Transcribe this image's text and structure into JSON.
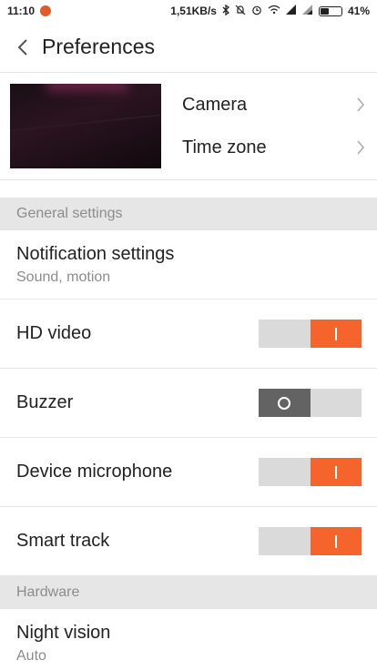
{
  "status_bar": {
    "time": "11:10",
    "speed": "1,51KB/s",
    "battery": "41%",
    "battery_level": 0.41
  },
  "header": {
    "title": "Preferences",
    "back_icon": "chevron-left-icon"
  },
  "camera_section": {
    "items": [
      {
        "label": "Camera",
        "icon": "chevron-right-icon"
      },
      {
        "label": "Time zone",
        "icon": "chevron-right-icon"
      }
    ]
  },
  "general": {
    "header": "General settings",
    "notification": {
      "title": "Notification settings",
      "subtitle": "Sound, motion"
    },
    "toggles": [
      {
        "label": "HD video",
        "on": true
      },
      {
        "label": "Buzzer",
        "on": false
      },
      {
        "label": "Device microphone",
        "on": true
      },
      {
        "label": "Smart track",
        "on": true
      }
    ]
  },
  "hardware": {
    "header": "Hardware",
    "night_vision": {
      "title": "Night vision",
      "subtitle": "Auto"
    }
  },
  "colors": {
    "accent": "#f4642b",
    "toggle_off": "#636363",
    "toggle_track": "#dadada",
    "section_bg": "#e6e6e6"
  }
}
